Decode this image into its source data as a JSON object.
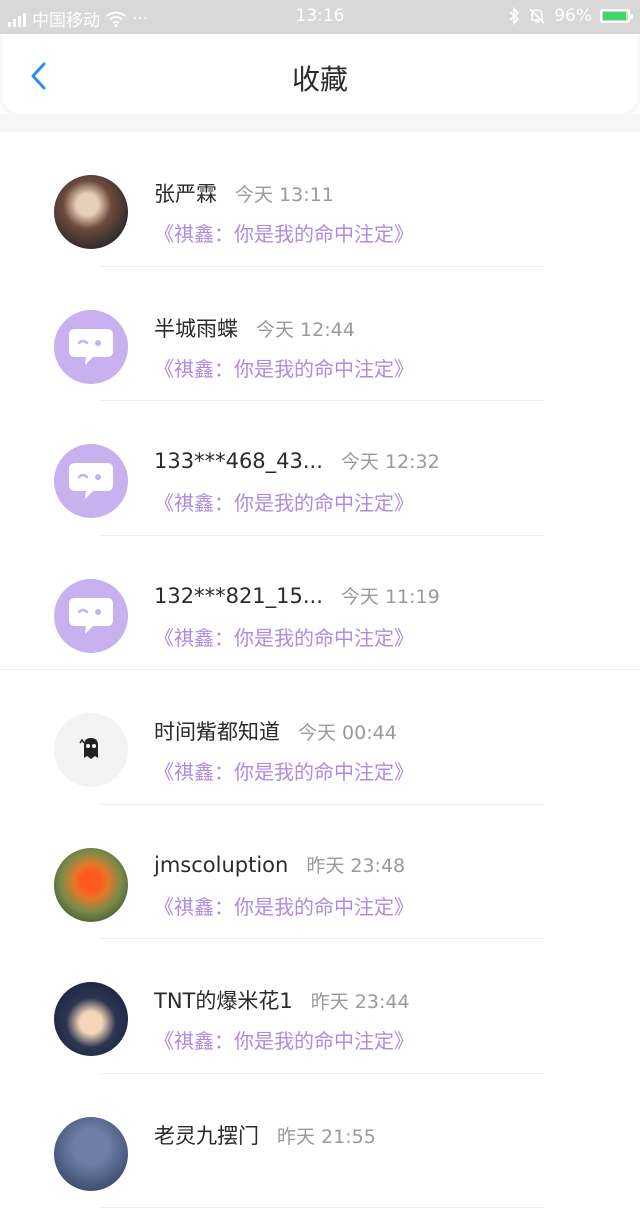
{
  "status_bar": {
    "carrier": "中国移动",
    "dots": "···",
    "time": "13:16",
    "battery": "96%",
    "battery_level": 0.96
  },
  "header": {
    "title": "收藏"
  },
  "colors": {
    "accent_back": "#2f8cf2",
    "message": "#b18be0",
    "default_avatar": "#c8b1ee"
  },
  "favorites": [
    {
      "name": "张严霖",
      "time": "今天 13:11",
      "message": "《祺鑫：你是我的命中注定》",
      "avatar": "photo"
    },
    {
      "name": "半城雨蝶",
      "time": "今天 12:44",
      "message": "《祺鑫：你是我的命中注定》",
      "avatar": "default"
    },
    {
      "name": "133***468_43...",
      "time": "今天 12:32",
      "message": "《祺鑫：你是我的命中注定》",
      "avatar": "default"
    },
    {
      "name": "132***821_15...",
      "time": "今天 11:19",
      "message": "《祺鑫：你是我的命中注定》",
      "avatar": "default"
    },
    {
      "name": "时间觜都知道",
      "time": "今天 00:44",
      "message": "《祺鑫：你是我的命中注定》",
      "avatar": "ghost"
    },
    {
      "name": "jmscoluption",
      "time": "昨天 23:48",
      "message": "《祺鑫：你是我的命中注定》",
      "avatar": "photo"
    },
    {
      "name": "TNT的爆米花1",
      "time": "昨天 23:44",
      "message": "《祺鑫：你是我的命中注定》",
      "avatar": "photo"
    },
    {
      "name": "老灵九摆门",
      "time": "昨天 21:55",
      "message": "",
      "avatar": "photo"
    }
  ]
}
